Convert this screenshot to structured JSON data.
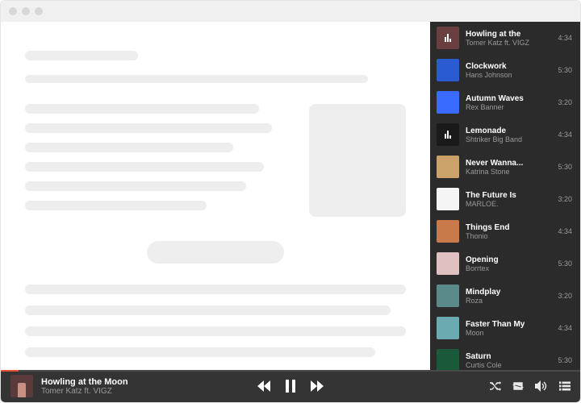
{
  "now_playing": {
    "title": "Howling at the Moon",
    "artist": "Tomer Katz ft. VIGZ"
  },
  "colors": {
    "accent": "#e84f33"
  },
  "tracks": [
    {
      "title": "Howling at the",
      "artist": "Tomer Katz ft. VIGZ",
      "duration": "4:34",
      "art": "#6b3f3f",
      "playing": true
    },
    {
      "title": "Clockwork",
      "artist": "Hans Johnson",
      "duration": "5:30",
      "art": "#2a5bd0",
      "playing": false
    },
    {
      "title": "Autumn Waves",
      "artist": "Rex Banner",
      "duration": "3:20",
      "art": "#3a6bff",
      "playing": false
    },
    {
      "title": "Lemonade",
      "artist": "Shtriker Big Band",
      "duration": "4:34",
      "art": "#1a1a1a",
      "playing": true
    },
    {
      "title": "Never Wanna...",
      "artist": "Katrina Stone",
      "duration": "5:30",
      "art": "#caa26a",
      "playing": false
    },
    {
      "title": "The Future Is",
      "artist": "MARLOE.",
      "duration": "3:20",
      "art": "#f5f5f5",
      "playing": false
    },
    {
      "title": "Things End",
      "artist": "Thonio",
      "duration": "4:34",
      "art": "#c97a4a",
      "playing": false
    },
    {
      "title": "Opening",
      "artist": "Borrtex",
      "duration": "5:30",
      "art": "#e0c0c0",
      "playing": false
    },
    {
      "title": "Mindplay",
      "artist": "Roza",
      "duration": "3:20",
      "art": "#5a8a8a",
      "playing": false
    },
    {
      "title": "Faster Than My",
      "artist": "Moon",
      "duration": "4:34",
      "art": "#6aaab0",
      "playing": false
    },
    {
      "title": "Saturn",
      "artist": "Curtis Cole",
      "duration": "5:30",
      "art": "#1a5a3a",
      "playing": false
    }
  ]
}
